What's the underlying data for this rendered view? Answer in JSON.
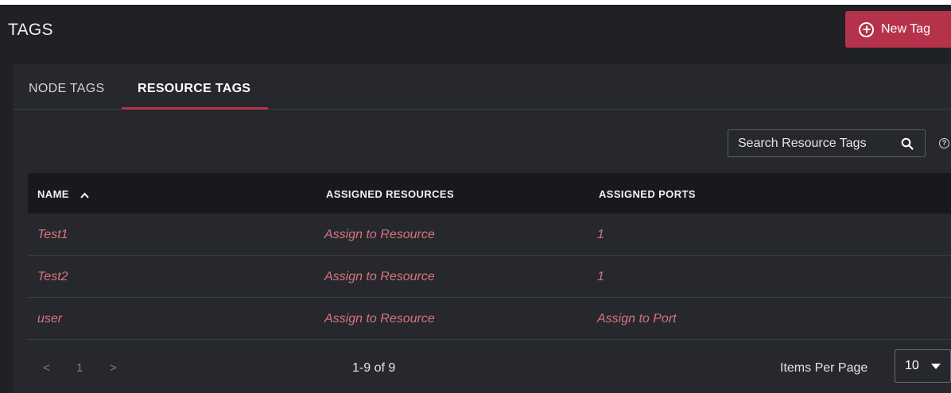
{
  "header": {
    "title": "TAGS",
    "new_button": "New Tag"
  },
  "tabs": [
    {
      "label": "NODE TAGS"
    },
    {
      "label": "RESOURCE TAGS",
      "active": true
    }
  ],
  "search": {
    "placeholder": "Search Resource Tags"
  },
  "help_icon": "?",
  "table": {
    "columns": [
      "NAME",
      "ASSIGNED RESOURCES",
      "ASSIGNED PORTS"
    ],
    "sort_column": "NAME",
    "sort_direction": "ascending",
    "rows": [
      {
        "name": "Test1",
        "resources": "Assign to Resource",
        "ports": "1"
      },
      {
        "name": "Test2",
        "resources": "Assign to Resource",
        "ports": "1"
      },
      {
        "name": "user",
        "resources": "Assign to Resource",
        "ports": "Assign to Port"
      }
    ]
  },
  "pagination": {
    "prev": "<",
    "page": "1",
    "next": ">",
    "range": "1-9 of 9",
    "items_per_page_label": "Items Per Page",
    "items_per_page": "10"
  },
  "colors": {
    "accent": "#b5324a",
    "link": "#d9737f",
    "background": "#1f2125",
    "panel": "#26282d",
    "header_row": "#18191c"
  }
}
